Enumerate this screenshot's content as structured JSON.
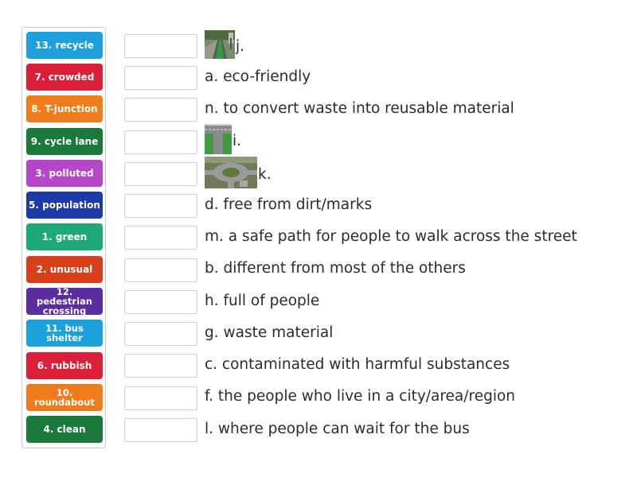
{
  "tiles": [
    {
      "label": "13. recycle",
      "color": "#1da1dc"
    },
    {
      "label": "7. crowded",
      "color": "#dc1f38"
    },
    {
      "label": "8. T-junction",
      "color": "#f07c1b"
    },
    {
      "label": "9. cycle lane",
      "color": "#1a7a3b"
    },
    {
      "label": "3. polluted",
      "color": "#b645c9"
    },
    {
      "label": "5. population",
      "color": "#1e3aa8"
    },
    {
      "label": "1. green",
      "color": "#1ea97a"
    },
    {
      "label": "2. unusual",
      "color": "#d8401c"
    },
    {
      "label": "12. pedestrian crossing",
      "color": "#5b2da3"
    },
    {
      "label": "11. bus shelter",
      "color": "#1da1dc"
    },
    {
      "label": "6. rubbish",
      "color": "#dc1f38"
    },
    {
      "label": "10. roundabout",
      "color": "#f07c1b"
    },
    {
      "label": "4. clean",
      "color": "#1a7a3b"
    }
  ],
  "definitions": [
    {
      "text": "j.",
      "image": "cycle-lane-photo"
    },
    {
      "text": "a. eco-friendly"
    },
    {
      "text": "n. to convert waste into reusable material"
    },
    {
      "text": "i.",
      "image": "t-junction-photo"
    },
    {
      "text": "k.",
      "image": "roundabout-photo"
    },
    {
      "text": "d. free from dirt/marks"
    },
    {
      "text": "m. a safe path for people to walk across the street"
    },
    {
      "text": "b. different from most of the others"
    },
    {
      "text": "h. full of people"
    },
    {
      "text": "g. waste material"
    },
    {
      "text": "c. contaminated with harmful substances"
    },
    {
      "text": "f. the people who live in a city/area/region"
    },
    {
      "text": "l. where people can wait for the bus"
    }
  ]
}
